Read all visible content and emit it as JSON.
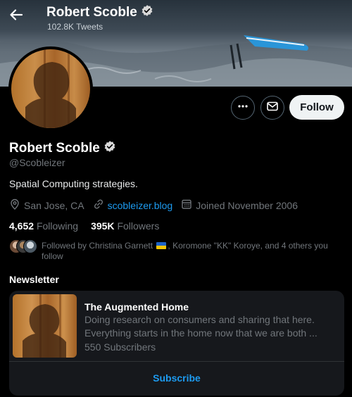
{
  "header": {
    "title": "Robert Scoble",
    "tweet_count": "102.8K Tweets"
  },
  "actions": {
    "follow_label": "Follow"
  },
  "profile": {
    "name": "Robert Scoble",
    "handle": "@Scobleizer",
    "bio": "Spatial Computing strategies.",
    "location": "San Jose, CA",
    "website": "scobleizer.blog",
    "joined": "Joined November 2006",
    "following_count": "4,652",
    "following_label": "Following",
    "followers_count": "395K",
    "followers_label": "Followers",
    "followed_by_prefix": "Followed by Christina Garnett",
    "followed_by_suffix": ", Koromone \"KK\" Koroye, and 4 others you follow"
  },
  "newsletter": {
    "section_title": "Newsletter",
    "title": "The Augmented Home",
    "description": "Doing research on consumers and sharing that here. Everything starts in the home now that we are both ...",
    "subscribers": "550 Subscribers",
    "subscribe_label": "Subscribe"
  },
  "colors": {
    "background": "#000000",
    "accent": "#1d9bf0",
    "verified_badge": "#d9d9d9",
    "secondary_text": "#71767b"
  },
  "icons": [
    "arrow-left-icon",
    "verified-badge-icon",
    "more-icon",
    "mail-icon",
    "location-icon",
    "link-icon",
    "calendar-icon"
  ]
}
